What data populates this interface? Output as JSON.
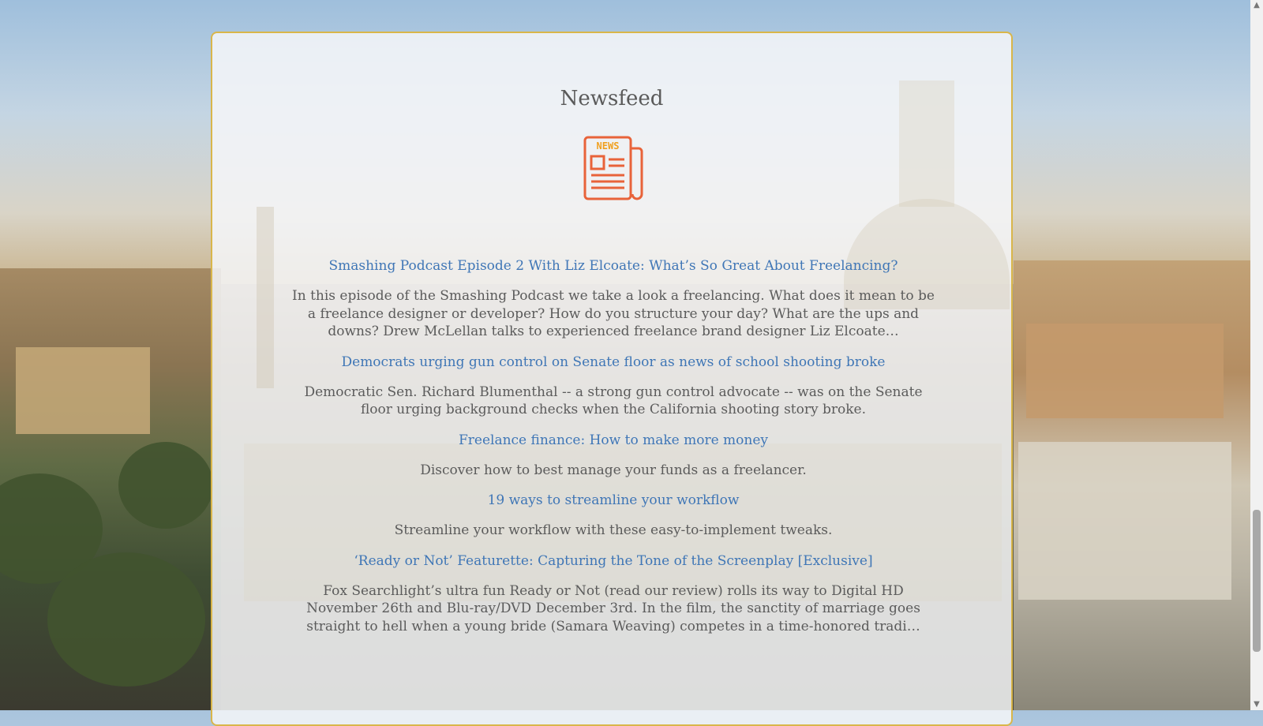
{
  "header": {
    "title": "Newsfeed"
  },
  "icon": {
    "name": "newspaper-icon",
    "label": "NEWS",
    "color": "#e8633a"
  },
  "colors": {
    "link": "#3f76b6",
    "text": "#5b5b5b",
    "card_border": "#d9b64a"
  },
  "feed": {
    "items": [
      {
        "title": "Smashing Podcast Episode 2 With Liz Elcoate: What’s So Great About Freelancing?",
        "description": "In this episode of the Smashing Podcast we take a look a freelancing. What does it mean to be a freelance designer or developer? How do you structure your day? What are the ups and downs? Drew McLellan talks to experienced freelance brand designer Liz Elcoate…"
      },
      {
        "title": "Democrats urging gun control on Senate floor as news of school shooting broke",
        "description": "Democratic Sen. Richard Blumenthal -- a strong gun control advocate -- was on the Senate floor urging background checks when the California shooting story broke."
      },
      {
        "title": "Freelance finance: How to make more money",
        "description": "Discover how to best manage your funds as a freelancer."
      },
      {
        "title": "19 ways to streamline your workflow",
        "description": "Streamline your workflow with these easy-to-implement tweaks."
      },
      {
        "title": "‘Ready or Not’ Featurette: Capturing the Tone of the Screenplay [Exclusive]",
        "description": "Fox Searchlight’s ultra fun Ready or Not (read our review) rolls its way to Digital HD November 26th and Blu-ray/DVD December 3rd. In the film, the sanctity of marriage goes straight to hell when a young bride (Samara Weaving) competes in a time-honored tradi…"
      }
    ]
  },
  "scrollbar": {
    "up_icon": "chevron-up-icon",
    "down_icon": "chevron-down-icon"
  }
}
